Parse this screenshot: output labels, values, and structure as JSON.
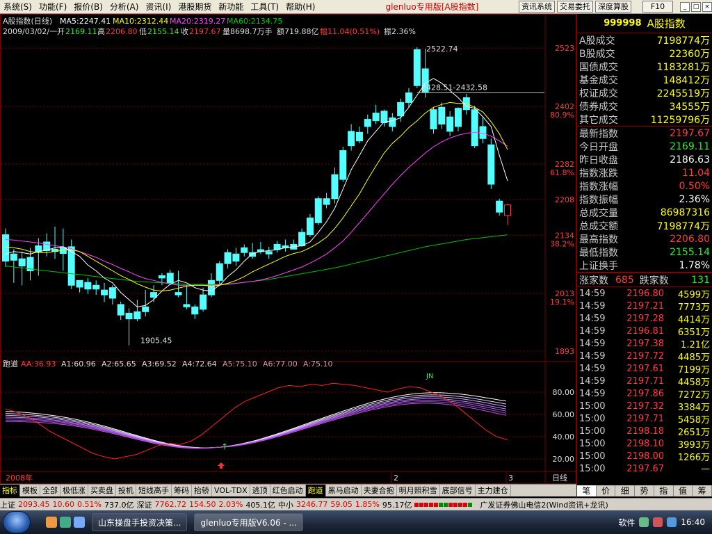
{
  "menu": {
    "items": [
      "系统(S)",
      "功能(F)",
      "报价(B)",
      "分析(A)",
      "资讯(I)",
      "港股期货",
      "新功能",
      "工具(T)",
      "帮助(H)"
    ],
    "app_title": "glenluo专用版",
    "app_index": "[A股指数]",
    "toolbar": [
      "资讯系统",
      "交易委托",
      "深度算股"
    ],
    "f10": "F10",
    "window": [
      "_",
      "□",
      "×"
    ]
  },
  "header": {
    "title": "A股指数(日线)",
    "ma5": "MA5:2247.41",
    "ma10": "MA10:2312.44",
    "ma20": "MA20:2319.27",
    "ma60": "MA60:2134.75",
    "date": "2009/03/02/一",
    "open_lbl": "开",
    "open": "2169.11",
    "high_lbl": "高",
    "high": "2206.80",
    "low_lbl": "低",
    "low": "2155.14",
    "close_lbl": "收",
    "close": "2197.67",
    "vol": "量8698.7万手",
    "amt": "额719.88亿",
    "chg": "幅11.04(0.51%)",
    "amp": "振2.36%"
  },
  "chart_data": {
    "type": "candlestick",
    "y_ticks": [
      "2523",
      "2402",
      "2282",
      "2208",
      "2134",
      "2013",
      "1893"
    ],
    "y_pct": [
      "80.9%",
      "61.8%",
      "38.2%",
      "19.1%"
    ],
    "annotations": [
      "2522.74",
      "2428.51-2432.58",
      "1905.45"
    ],
    "x_labels": [
      "2008年",
      "2",
      "3"
    ],
    "period": "日线",
    "ylim": [
      1880,
      2545
    ],
    "candles": [
      [
        2135,
        2148,
        2080,
        2068
      ],
      [
        2095,
        2105,
        2082,
        2035
      ],
      [
        2085,
        2100,
        2070,
        2030
      ],
      [
        2088,
        2108,
        2060,
        2040
      ],
      [
        2112,
        2128,
        2100,
        2050
      ],
      [
        2120,
        2138,
        2102,
        2090
      ],
      [
        2105,
        2152,
        2100,
        2085
      ],
      [
        2108,
        2148,
        2096,
        2060
      ],
      [
        2110,
        2125,
        2030,
        2022
      ],
      [
        2040,
        2040,
        2026,
        2015
      ],
      [
        2036,
        2045,
        2022,
        2012
      ],
      [
        2030,
        2040,
        2022,
        2010
      ],
      [
        2020,
        2035,
        2010,
        1995
      ],
      [
        2025,
        2030,
        2003,
        1990
      ],
      [
        1990,
        1996,
        1968,
        1958
      ],
      [
        1972,
        1982,
        1960,
        1905
      ],
      [
        1975,
        2000,
        1960,
        1955
      ],
      [
        1985,
        2020,
        1975,
        1965
      ],
      [
        2015,
        2030,
        2005,
        1995
      ],
      [
        2050,
        2055,
        2045,
        2030
      ],
      [
        2055,
        2062,
        2035,
        2030
      ],
      [
        2015,
        2060,
        2010,
        2005
      ],
      [
        1990,
        2030,
        1985,
        1980
      ],
      [
        1985,
        1990,
        1970,
        1960
      ],
      [
        2010,
        2025,
        1980,
        1975
      ],
      [
        2040,
        2055,
        2010,
        2005
      ],
      [
        2075,
        2080,
        2040,
        2030
      ],
      [
        2098,
        2105,
        2075,
        2065
      ],
      [
        2095,
        2108,
        2080,
        2070
      ],
      [
        2108,
        2115,
        2098,
        2090
      ],
      [
        2098,
        2118,
        2090,
        2085
      ],
      [
        2104,
        2120,
        2100,
        2095
      ],
      [
        2100,
        2110,
        2095,
        2085
      ],
      [
        2115,
        2122,
        2104,
        2098
      ],
      [
        2112,
        2125,
        2108,
        2100
      ],
      [
        2115,
        2125,
        2105,
        2105
      ],
      [
        2140,
        2148,
        2112,
        2110
      ],
      [
        2170,
        2178,
        2135,
        2130
      ],
      [
        2210,
        2215,
        2160,
        2155
      ],
      [
        2210,
        2222,
        2198,
        2190
      ],
      [
        2260,
        2275,
        2210,
        2200
      ],
      [
        2310,
        2318,
        2250,
        2245
      ],
      [
        2350,
        2365,
        2320,
        2310
      ],
      [
        2348,
        2360,
        2330,
        2325
      ],
      [
        2375,
        2385,
        2360,
        2345
      ],
      [
        2388,
        2405,
        2372,
        2365
      ],
      [
        2392,
        2395,
        2368,
        2360
      ],
      [
        2378,
        2388,
        2360,
        2350
      ],
      [
        2410,
        2418,
        2382,
        2370
      ],
      [
        2430,
        2440,
        2410,
        2400
      ],
      [
        2520,
        2525,
        2445,
        2440
      ],
      [
        2480,
        2522,
        2432,
        2420
      ],
      [
        2395,
        2400,
        2355,
        2345
      ],
      [
        2400,
        2410,
        2365,
        2355
      ],
      [
        2380,
        2392,
        2350,
        2340
      ],
      [
        2398,
        2400,
        2360,
        2350
      ],
      [
        2420,
        2428,
        2395,
        2385
      ],
      [
        2395,
        2403,
        2320,
        2315
      ],
      [
        2360,
        2380,
        2335,
        2325
      ],
      [
        2322,
        2335,
        2240,
        2230
      ],
      [
        2205,
        2210,
        2182,
        2175
      ],
      [
        2175,
        2200,
        2197,
        2155
      ]
    ],
    "mas": {
      "ma5": [
        2095,
        2100,
        2098,
        2095,
        2100,
        2103,
        2108,
        2110,
        2100,
        2090,
        2072,
        2060,
        2045,
        2035,
        2015,
        2000,
        1985,
        1988,
        2000,
        2018,
        2032,
        2040,
        2035,
        2025,
        2020,
        2018,
        2030,
        2048,
        2062,
        2080,
        2096,
        2100,
        2102,
        2104,
        2108,
        2110,
        2112,
        2120,
        2140,
        2162,
        2190,
        2230,
        2270,
        2300,
        2330,
        2350,
        2370,
        2372,
        2378,
        2400,
        2425,
        2450,
        2460,
        2450,
        2435,
        2420,
        2402,
        2398,
        2380,
        2360,
        2300,
        2247
      ],
      "ma10": [
        2110,
        2108,
        2105,
        2100,
        2098,
        2098,
        2100,
        2103,
        2104,
        2100,
        2090,
        2080,
        2070,
        2060,
        2050,
        2042,
        2033,
        2026,
        2020,
        2018,
        2020,
        2024,
        2028,
        2030,
        2030,
        2028,
        2030,
        2034,
        2040,
        2048,
        2058,
        2066,
        2074,
        2082,
        2090,
        2096,
        2100,
        2108,
        2118,
        2130,
        2148,
        2170,
        2195,
        2220,
        2250,
        2278,
        2305,
        2325,
        2340,
        2358,
        2372,
        2388,
        2400,
        2406,
        2410,
        2408,
        2408,
        2400,
        2390,
        2370,
        2345,
        2312
      ],
      "ma20": [
        2125,
        2124,
        2122,
        2120,
        2118,
        2115,
        2112,
        2110,
        2106,
        2100,
        2094,
        2088,
        2080,
        2073,
        2065,
        2058,
        2050,
        2044,
        2040,
        2036,
        2033,
        2030,
        2030,
        2030,
        2030,
        2030,
        2031,
        2032,
        2034,
        2036,
        2038,
        2041,
        2045,
        2050,
        2056,
        2062,
        2068,
        2076,
        2085,
        2095,
        2108,
        2122,
        2140,
        2160,
        2180,
        2200,
        2220,
        2240,
        2258,
        2275,
        2290,
        2305,
        2318,
        2328,
        2336,
        2342,
        2346,
        2348,
        2346,
        2340,
        2330,
        2319
      ],
      "ma60": [
        2070,
        2068,
        2066,
        2064,
        2062,
        2060,
        2058,
        2056,
        2054,
        2052,
        2050,
        2048,
        2046,
        2044,
        2042,
        2040,
        2038,
        2037,
        2036,
        2035,
        2034,
        2033,
        2032,
        2032,
        2032,
        2032,
        2032,
        2033,
        2034,
        2036,
        2038,
        2040,
        2042,
        2045,
        2048,
        2051,
        2054,
        2057,
        2060,
        2063,
        2066,
        2070,
        2074,
        2078,
        2082,
        2086,
        2090,
        2094,
        2098,
        2102,
        2106,
        2110,
        2113,
        2116,
        2119,
        2122,
        2125,
        2127,
        2129,
        2131,
        2133,
        2134.75
      ]
    },
    "indicator": {
      "name": "跑道",
      "labels": [
        "AA:36.93",
        "A1:60.96",
        "A2:65.65",
        "A3:69.52",
        "A4:72.64",
        "A5:75.10",
        "A6:77.00",
        "A:75.10"
      ],
      "y_ticks": [
        "80.00",
        "60.00",
        "40.00",
        "20.00"
      ],
      "ylim": [
        0,
        100
      ],
      "marks": [
        "JN"
      ]
    }
  },
  "right_panel": {
    "code": "999998",
    "name": "A股指数",
    "turnover": [
      {
        "label": "A股成交",
        "value": "7198774万"
      },
      {
        "label": "B股成交",
        "value": "22360万"
      },
      {
        "label": "国债成交",
        "value": "1183281万"
      },
      {
        "label": "基金成交",
        "value": "148412万"
      },
      {
        "label": "权证成交",
        "value": "2245519万"
      },
      {
        "label": "债券成交",
        "value": "34555万"
      },
      {
        "label": "其它成交",
        "value": "11259796万"
      }
    ],
    "stats": [
      {
        "label": "最新指数",
        "value": "2197.67",
        "cls": "upc"
      },
      {
        "label": "今日开盘",
        "value": "2169.11",
        "cls": "dnc"
      },
      {
        "label": "昨日收盘",
        "value": "2186.63",
        "cls": "whc"
      },
      {
        "label": "指数涨跌",
        "value": "11.04",
        "cls": "upc"
      },
      {
        "label": "指数涨幅",
        "value": "0.50%",
        "cls": "upc"
      },
      {
        "label": "指数振幅",
        "value": "2.36%",
        "cls": "whc"
      },
      {
        "label": "总成交量",
        "value": "86987316",
        "cls": "ylc"
      },
      {
        "label": "总成交额",
        "value": "7198774万",
        "cls": "ylc"
      },
      {
        "label": "最高指数",
        "value": "2206.80",
        "cls": "upc"
      },
      {
        "label": "最低指数",
        "value": "2155.14",
        "cls": "dnc"
      },
      {
        "label": "上证换手",
        "value": "1.78%",
        "cls": "whc"
      }
    ],
    "rise_label": "涨家数",
    "rise": "685",
    "fall_label": "跌家数",
    "fall": "131",
    "ticks": [
      [
        "14:59",
        "2196.80",
        "4599万"
      ],
      [
        "14:59",
        "2197.21",
        "7773万"
      ],
      [
        "14:59",
        "2197.28",
        "4414万"
      ],
      [
        "14:59",
        "2196.81",
        "6351万"
      ],
      [
        "14:59",
        "2197.38",
        "1.21亿"
      ],
      [
        "14:59",
        "2197.72",
        "4485万"
      ],
      [
        "14:59",
        "2197.61",
        "7199万"
      ],
      [
        "14:59",
        "2197.71",
        "4458万"
      ],
      [
        "14:59",
        "2197.86",
        "7272万"
      ],
      [
        "15:00",
        "2197.32",
        "3384万"
      ],
      [
        "15:00",
        "2197.71",
        "5458万"
      ],
      [
        "15:00",
        "2198.18",
        "2651万"
      ],
      [
        "15:00",
        "2198.10",
        "3993万"
      ],
      [
        "15:00",
        "2198.00",
        "1266万"
      ],
      [
        "15:00",
        "2197.67",
        "—"
      ]
    ],
    "tabs": [
      "笔",
      "价",
      "细",
      "势",
      "指",
      "值",
      "筹"
    ]
  },
  "formula_tabs": [
    "指标",
    "模板",
    "全部",
    "极低涨",
    "买卖盘",
    "投机",
    "短线高手",
    "筹码",
    "抬轿",
    "VOL-TDX",
    "逃顶",
    "红色启动",
    "跑道",
    "黑马启动",
    "夫妻合抱",
    "明月照积雪",
    "底部信号",
    "主力建仓"
  ],
  "status": {
    "sh_lbl": "上证",
    "sh": "2093.45",
    "sh_chg": "10.60",
    "sh_pct": "0.51%",
    "sh_amt": "737.0亿",
    "sz_lbl": "深证",
    "sz": "7762.72",
    "sz_chg": "154.50",
    "sz_pct": "2.03%",
    "sz_amt": "405.1亿",
    "zx_lbl": "中小",
    "zx": "3246.77",
    "zx_chg": "59.05",
    "zx_pct": "1.85%",
    "zx_amt": "95.17亿",
    "broker": "广发证券佛山电信2(Wind资讯+龙讯)"
  },
  "taskbar": {
    "tasks": [
      "山东操盘手投资决策...",
      "glenluo专用版V6.06 - ..."
    ],
    "tray_label": "软件",
    "clock": "16:40"
  },
  "colors": {
    "up": "#ff3c3c",
    "down": "#54ffff",
    "ma5": "#ffffff",
    "ma10": "#ffff00",
    "ma20": "#ff44ff",
    "ma60": "#00c000",
    "grid": "#7a0000",
    "aa": "#ff2020"
  }
}
